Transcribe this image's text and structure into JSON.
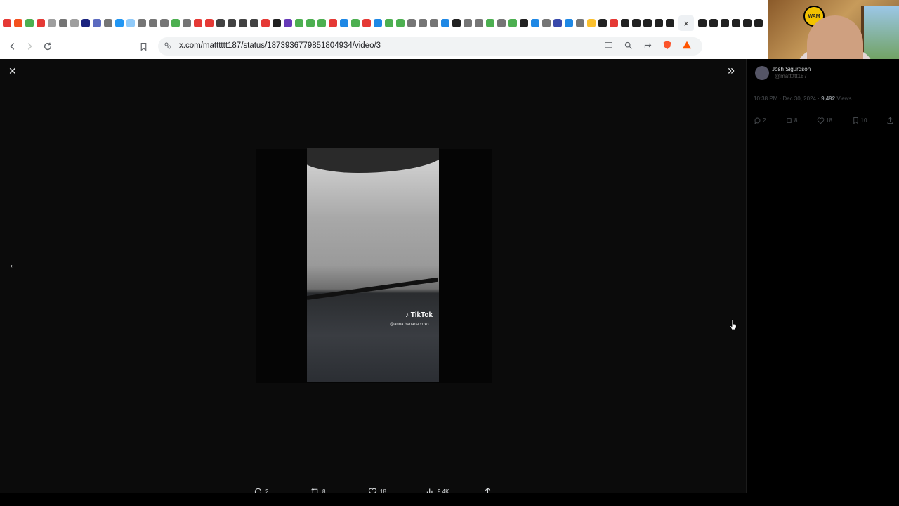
{
  "browser": {
    "url": "x.com/matttttt187/status/1873936779851804934/video/3",
    "tab_close_glyph": "×",
    "tab_icon_colors": [
      "#e53935",
      "#f4511e",
      "#4caf50",
      "#e53935",
      "#9e9e9e",
      "#757575",
      "#9e9e9e",
      "#1a237e",
      "#5c6bc0",
      "#757575",
      "#2196f3",
      "#90caf9",
      "#757575",
      "#757575",
      "#757575",
      "#4caf50",
      "#757575",
      "#e53935",
      "#e53935",
      "#424242",
      "#424242",
      "#424242",
      "#424242",
      "#e53935",
      "#212121",
      "#673ab7",
      "#4caf50",
      "#4caf50",
      "#4caf50",
      "#e53935",
      "#1e88e5",
      "#4caf50",
      "#e53935",
      "#1e88e5",
      "#4caf50",
      "#4caf50",
      "#757575",
      "#757575",
      "#757575",
      "#1e88e5",
      "#212121",
      "#757575",
      "#757575",
      "#4caf50",
      "#757575",
      "#4caf50",
      "#212121",
      "#1e88e5",
      "#757575",
      "#3949ab",
      "#1e88e5",
      "#757575",
      "#fbc02d",
      "#212121",
      "#e53935",
      "#212121",
      "#212121",
      "#212121",
      "#212121",
      "#212121"
    ],
    "tab_right_count": 6
  },
  "viewer": {
    "close_glyph": "✕",
    "expand_glyph": "»",
    "prev_glyph": "←",
    "video_watermark": "TikTok",
    "video_handle": "@anna.banana.xoxo",
    "actions": {
      "replies": "2",
      "reposts": "8",
      "likes": "18",
      "views": "9.4K"
    }
  },
  "panel": {
    "name": "Josh Sigurdson",
    "handle": "@matttttt187",
    "time": "10:38 PM · Dec 30, 2024 · ",
    "views_count": "9,492",
    "views_label": " Views",
    "replies": "2",
    "reposts": "8",
    "likes": "18",
    "bookmarks": "10"
  },
  "webcam": {
    "logo_text": "WAM"
  }
}
